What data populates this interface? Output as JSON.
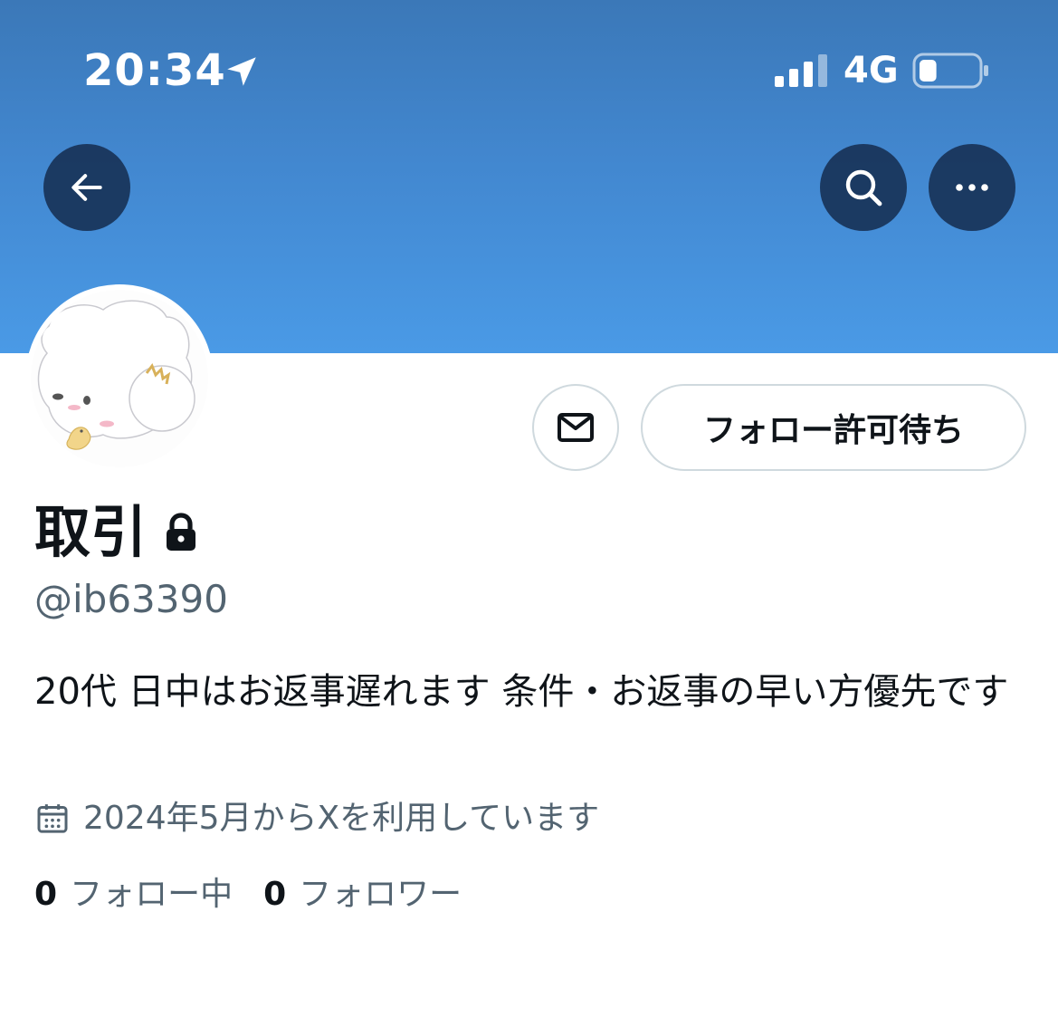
{
  "status_bar": {
    "time": "20:34",
    "network": "4G",
    "location_icon": "location-arrow-icon",
    "signal_icon": "signal-bars-icon",
    "battery_icon": "battery-icon",
    "battery_level": 0.3
  },
  "header": {
    "back_icon": "arrow-left-icon",
    "search_icon": "search-icon",
    "more_icon": "more-horizontal-icon",
    "banner_color": "#4a9ae6"
  },
  "profile": {
    "display_name": "取引",
    "protected_icon": "lock-icon",
    "handle": "@ib63390",
    "bio": "20代 日中はお返事遅れます 条件・お返事の早い方優先です",
    "joined": "2024年5月からXを利用しています",
    "joined_icon": "calendar-icon"
  },
  "actions": {
    "message_icon": "mail-icon",
    "follow_label": "フォロー許可待ち"
  },
  "stats": {
    "following_count": "0",
    "following_label": "フォロー中",
    "followers_count": "0",
    "followers_label": "フォロワー"
  }
}
